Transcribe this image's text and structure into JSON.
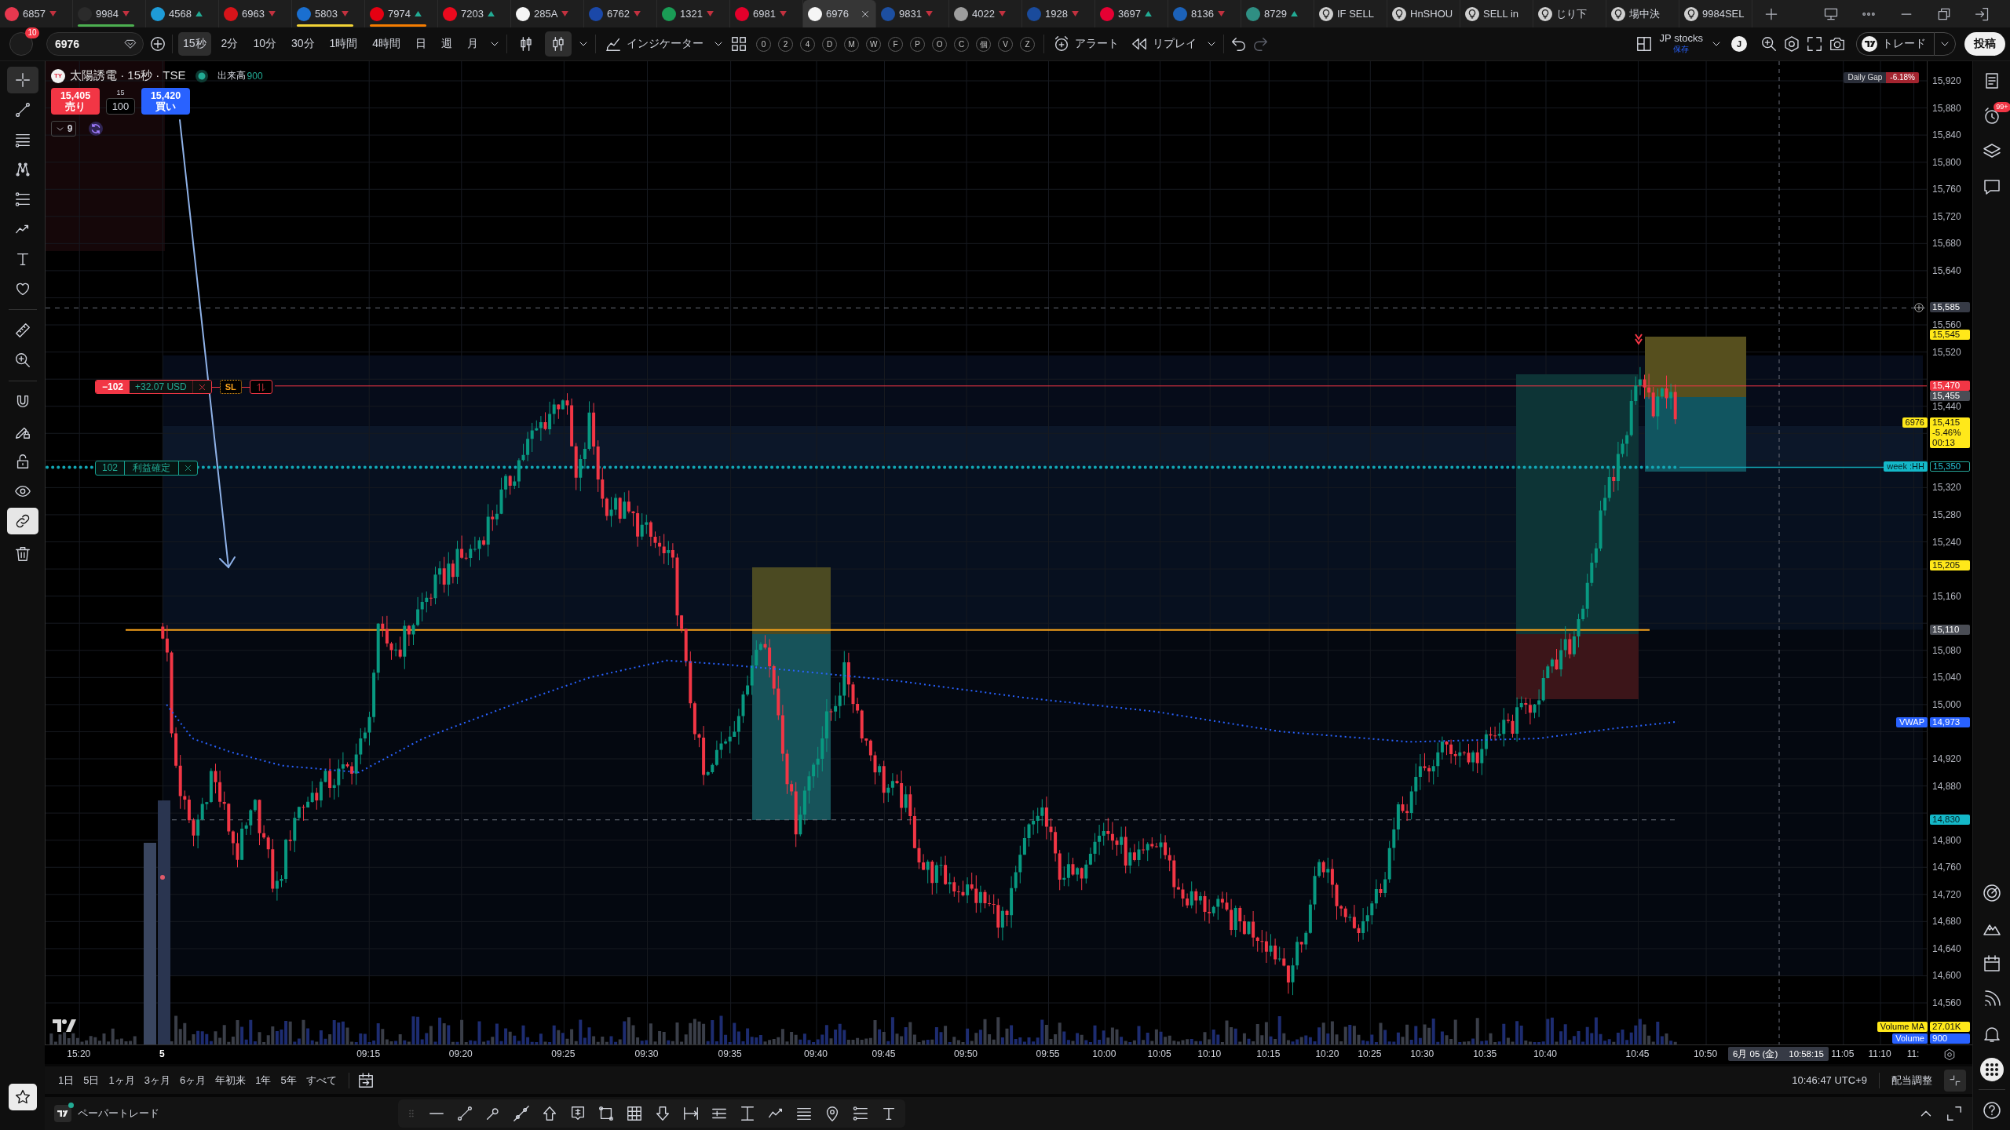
{
  "tabs": [
    {
      "kind": "symbol",
      "label": "6857",
      "rising": false,
      "color": "#e8384f",
      "selected": false
    },
    {
      "kind": "symbol",
      "label": "9984",
      "rising": false,
      "color": "#2b2b2b",
      "flag": {
        "color": "#4caf50"
      },
      "selected": false
    },
    {
      "kind": "symbol",
      "label": "4568",
      "rising": true,
      "color": "#1e9bd7",
      "selected": false
    },
    {
      "kind": "symbol",
      "label": "6963",
      "rising": false,
      "color": "#d7141a",
      "selected": false
    },
    {
      "kind": "symbol",
      "label": "5803",
      "rising": false,
      "color": "#1a6fd0",
      "flag": {
        "color": "#f2d335"
      },
      "selected": false
    },
    {
      "kind": "symbol",
      "label": "7974",
      "rising": true,
      "color": "#e60012",
      "flag": {
        "color": "#f57c00"
      },
      "selected": false
    },
    {
      "kind": "symbol",
      "label": "7203",
      "rising": true,
      "color": "#eb0a1e",
      "selected": false
    },
    {
      "kind": "symbol",
      "label": "285A",
      "rising": false,
      "color": "#f5f5f5",
      "selected": false
    },
    {
      "kind": "symbol",
      "label": "6762",
      "rising": false,
      "color": "#1b48a8",
      "selected": false
    },
    {
      "kind": "symbol",
      "label": "1321",
      "rising": false,
      "color": "#1a9c55",
      "selected": false
    },
    {
      "kind": "symbol",
      "label": "6981",
      "rising": false,
      "color": "#e4002b",
      "selected": false
    },
    {
      "kind": "symbol",
      "label": "6976",
      "color": "#f5f5f5",
      "selected": true
    },
    {
      "kind": "symbol",
      "label": "9831",
      "rising": false,
      "color": "#1d4fa0",
      "selected": false
    },
    {
      "kind": "symbol",
      "label": "4022",
      "rising": false,
      "color": "#9e9e9e",
      "selected": false
    },
    {
      "kind": "symbol",
      "label": "1928",
      "rising": false,
      "color": "#1a4b9c",
      "selected": false
    },
    {
      "kind": "symbol",
      "label": "3697",
      "rising": true,
      "color": "#e60033",
      "selected": false
    },
    {
      "kind": "symbol",
      "label": "8136",
      "rising": false,
      "color": "#1c62b9",
      "selected": false
    },
    {
      "kind": "symbol",
      "label": "8729",
      "rising": true,
      "color": "#2f8f83",
      "selected": false
    },
    {
      "kind": "alert",
      "label": "IF SELL",
      "selected": false
    },
    {
      "kind": "alert",
      "label": "HnSHOU",
      "selected": false
    },
    {
      "kind": "alert",
      "label": "SELL in",
      "selected": false
    },
    {
      "kind": "alert",
      "label": "じり下",
      "selected": false
    },
    {
      "kind": "alert",
      "label": "場中決",
      "selected": false
    },
    {
      "kind": "alert",
      "label": "9984SEL",
      "selected": false
    }
  ],
  "toolbar": {
    "notifications": "10",
    "symbol": "6976",
    "intervals": [
      {
        "label": "15秒",
        "selected": true
      },
      {
        "label": "2分",
        "selected": false
      },
      {
        "label": "10分",
        "selected": false
      },
      {
        "label": "30分",
        "selected": false
      },
      {
        "label": "1時間",
        "selected": false
      },
      {
        "label": "4時間",
        "selected": false
      },
      {
        "label": "日",
        "selected": false
      },
      {
        "label": "週",
        "selected": false
      },
      {
        "label": "月",
        "selected": false
      }
    ],
    "chart_types": [
      {
        "kind": "candles",
        "selected": false
      },
      {
        "kind": "hollow-candles",
        "selected": true
      }
    ],
    "indicators_label": "インジケーター",
    "quick_buttons": [
      "0",
      "2",
      "4",
      "D",
      "M",
      "W",
      "F",
      "P",
      "O",
      "C",
      "個",
      "V",
      "Z"
    ],
    "alert_label": "アラート",
    "replay_label": "リプレイ",
    "layout_name": "JP stocks",
    "save_status": "保存",
    "user_initial": "J",
    "trade_label": "トレード",
    "publish_label": "投稿"
  },
  "left_toolbar": {
    "tools": [
      {
        "kind": "crosshair",
        "selected": true
      },
      {
        "kind": "trend-line",
        "selected": false
      },
      {
        "kind": "horizontal-lines",
        "selected": false
      },
      {
        "kind": "pattern-nodes",
        "selected": false
      },
      {
        "kind": "long-short-lines",
        "selected": false
      },
      {
        "kind": "forecast-arrow",
        "selected": false
      },
      {
        "kind": "text",
        "selected": false
      },
      {
        "kind": "heart",
        "selected": false
      }
    ],
    "measure": [
      {
        "kind": "ruler",
        "selected": false
      },
      {
        "kind": "zoom-in",
        "selected": false
      }
    ],
    "toggles": [
      {
        "kind": "magnet",
        "on": false
      },
      {
        "kind": "pencil-lock",
        "on": false
      },
      {
        "kind": "lock",
        "on": false
      },
      {
        "kind": "eye",
        "on": false
      },
      {
        "kind": "link",
        "on": true
      }
    ]
  },
  "chart": {
    "symbol_logo": "TY",
    "title": "太陽誘電 · 15秒 · TSE",
    "market_open": true,
    "volume_label": "出来高",
    "volume_value": "900",
    "order_panel": {
      "sell_price": "15,405",
      "sell_label": "売り",
      "spread": "15",
      "quantity": "100",
      "buy_price": "15,420",
      "buy_label": "買い"
    },
    "indicator_count": "9",
    "position": {
      "quantity": "−102",
      "pnl": "+32.07 USD",
      "stop_label": "SL"
    },
    "take_profit": {
      "quantity": "102",
      "label": "利益確定"
    },
    "daily_gap": {
      "label": "Daily Gap",
      "value": "-6.18%"
    },
    "price_scale": [
      "15,920",
      "15,880",
      "15,840",
      "15,800",
      "15,760",
      "15,720",
      "15,680",
      "15,640",
      "15,560",
      "15,520",
      "15,440",
      "15,320",
      "15,280",
      "15,240",
      "15,160",
      "15,080",
      "15,040",
      "15,000",
      "14,920",
      "14,880",
      "14,800",
      "14,760",
      "14,720",
      "14,680",
      "14,640",
      "14,600",
      "14,560"
    ],
    "price_labels": [
      {
        "kind": "crosshair",
        "text": "15,585"
      },
      {
        "kind": "alert",
        "text": "15,545"
      },
      {
        "kind": "position",
        "text": "15,470"
      },
      {
        "kind": "level",
        "text": "15,455"
      },
      {
        "kind": "last",
        "tag": "6976",
        "text": "15,415",
        "change": "-5.46%",
        "countdown": "00:13"
      },
      {
        "kind": "week-high",
        "tag": "week :HH",
        "text": "15,350"
      },
      {
        "kind": "alert",
        "text": "15,205"
      },
      {
        "kind": "level",
        "text": "15,110"
      },
      {
        "kind": "vwap",
        "tag": "VWAP",
        "text": "14,973"
      },
      {
        "kind": "indicator",
        "text": "14,830"
      },
      {
        "kind": "volume-ma",
        "tag": "Volume MA",
        "text": "27.01K"
      },
      {
        "kind": "volume",
        "tag": "Volume",
        "text": "900"
      }
    ],
    "time_scale": [
      {
        "kind": "time",
        "label": "15:20"
      },
      {
        "kind": "day",
        "label": "5"
      },
      {
        "kind": "time",
        "label": "09:15"
      },
      {
        "kind": "time",
        "label": "09:20"
      },
      {
        "kind": "time",
        "label": "09:25"
      },
      {
        "kind": "time",
        "label": "09:30"
      },
      {
        "kind": "time",
        "label": "09:35"
      },
      {
        "kind": "time",
        "label": "09:40"
      },
      {
        "kind": "time",
        "label": "09:45"
      },
      {
        "kind": "time",
        "label": "09:50"
      },
      {
        "kind": "time",
        "label": "09:55"
      },
      {
        "kind": "time",
        "label": "10:00"
      },
      {
        "kind": "time",
        "label": "10:05"
      },
      {
        "kind": "time",
        "label": "10:10"
      },
      {
        "kind": "time",
        "label": "10:15"
      },
      {
        "kind": "time",
        "label": "10:20"
      },
      {
        "kind": "time",
        "label": "10:25"
      },
      {
        "kind": "time",
        "label": "10:30"
      },
      {
        "kind": "time",
        "label": "10:35"
      },
      {
        "kind": "time",
        "label": "10:40"
      },
      {
        "kind": "time",
        "label": "10:45"
      },
      {
        "kind": "time",
        "label": "10:50"
      },
      {
        "kind": "time",
        "label": "11:05"
      },
      {
        "kind": "time",
        "label": "11:10"
      },
      {
        "kind": "time",
        "label": "11:"
      }
    ],
    "crosshair_time": {
      "date": "6月 05 (金)",
      "time": "10:58:15"
    }
  },
  "range_bar": {
    "ranges": [
      "1日",
      "5日",
      "1ヶ月",
      "3ヶ月",
      "6ヶ月",
      "年初来",
      "1年",
      "5年",
      "すべて"
    ],
    "clock": "10:46:47 UTC+9",
    "adjust_label": "配当調整"
  },
  "bottom_panel": {
    "label": "ペーパートレード",
    "connected": true
  },
  "right_sidebar": {
    "alerts_badge": "99+"
  }
}
